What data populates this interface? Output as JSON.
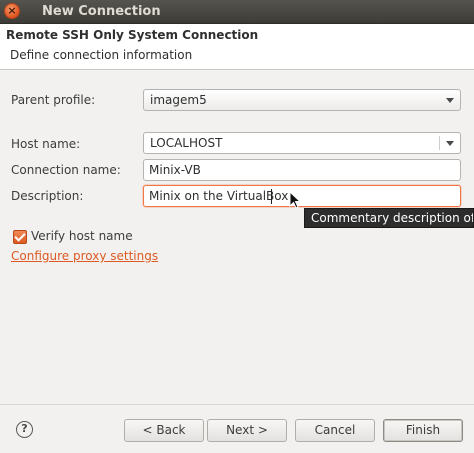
{
  "window": {
    "title": "New Connection"
  },
  "header": {
    "title": "Remote SSH Only System Connection",
    "subtitle": "Define connection information"
  },
  "form": {
    "parent_profile": {
      "label": "Parent profile:",
      "value": "imagem5"
    },
    "host_name": {
      "label": "Host name:",
      "value": "LOCALHOST"
    },
    "connection_name": {
      "label": "Connection name:",
      "value": "Minix-VB"
    },
    "description": {
      "label": "Description:",
      "value": "Minix on the VirtualBox"
    },
    "verify_host": {
      "label": "Verify host name",
      "checked": true
    },
    "proxy_link": "Configure proxy settings"
  },
  "tooltip": "Commentary description of the",
  "buttons": {
    "help": "?",
    "back": "< Back",
    "next": "Next >",
    "cancel": "Cancel",
    "finish": "Finish"
  },
  "colors": {
    "accent": "#dd5a23",
    "titlebar": "#3c3b37"
  }
}
